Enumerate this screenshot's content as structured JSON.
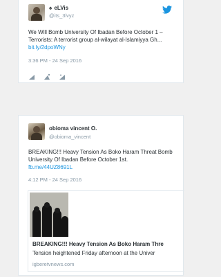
{
  "tweets": [
    {
      "name": "eLVis",
      "name_prefix": "♠",
      "handle": "@its_3lvyz",
      "text": "We Will Bomb University  Of Ibadan Before October 1 – Terrorists:  A terrorist  group al-wilayat  al-Islamiyya  Gh...",
      "link": "bit.ly/2dpoWNy",
      "timestamp": "3:36  PM  - 24 Sep 2016",
      "actions": [
        "reply-icon",
        "retweet-icon",
        "like-icon"
      ]
    },
    {
      "name": "obioma vincent  O.",
      "handle": "@obioma_vincent",
      "text": "BREAKING!!! Heavy   Tension  As Boko  Haram Threat Bomb University  Of Ibadan Before October 1st.",
      "link": "fb.me/44UZ8691L",
      "timestamp": "4:12  PM  - 24 Sep 2016",
      "card": {
        "title": "BREAKING!!! Heavy   Tension  As Boko  Haram Thre",
        "description": "Tension heightened Friday afternoon at the Univer",
        "domain": "igberetvnews.com"
      }
    }
  ],
  "colors": {
    "link": "#1b95e0",
    "muted": "#8899a6",
    "text": "#292f33",
    "border": "#e1e8ed"
  }
}
